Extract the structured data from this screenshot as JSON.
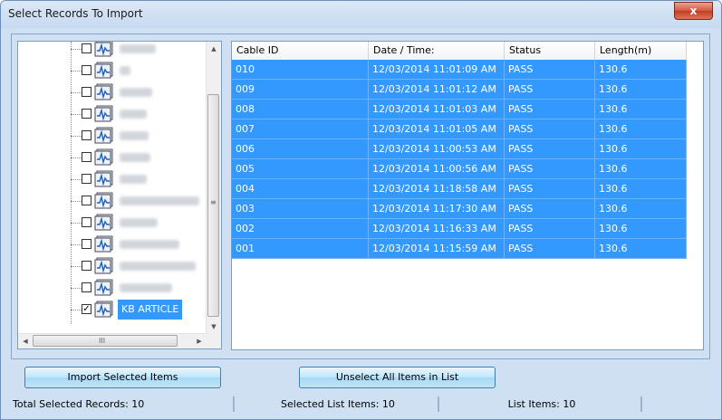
{
  "window": {
    "title": "Select Records To Import",
    "close_glyph": "x",
    "accent": "#3399ff"
  },
  "tree": {
    "nodes": [
      {
        "checked": false,
        "label_redacted": true,
        "icon": "cable-test-icon"
      },
      {
        "checked": false,
        "label_redacted": true,
        "icon": "cable-test-icon"
      },
      {
        "checked": false,
        "label_redacted": true,
        "icon": "cable-test-icon"
      },
      {
        "checked": false,
        "label_redacted": true,
        "icon": "cable-test-icon"
      },
      {
        "checked": false,
        "label_redacted": true,
        "icon": "cable-test-icon"
      },
      {
        "checked": false,
        "label_redacted": true,
        "icon": "cable-test-icon"
      },
      {
        "checked": false,
        "label_redacted": true,
        "icon": "cable-test-icon"
      },
      {
        "checked": false,
        "label_redacted": true,
        "icon": "cable-test-icon"
      },
      {
        "checked": false,
        "label_redacted": true,
        "icon": "cable-test-icon"
      },
      {
        "checked": false,
        "label_redacted": true,
        "icon": "cable-test-icon"
      },
      {
        "checked": false,
        "label_redacted": true,
        "icon": "cable-test-icon"
      },
      {
        "checked": false,
        "label_redacted": true,
        "icon": "cable-test-icon"
      },
      {
        "checked": true,
        "label": "KB ARTICLE",
        "selected": true,
        "icon": "cable-test-icon"
      }
    ],
    "hscroll_grip": "III"
  },
  "grid": {
    "columns": [
      "Cable ID",
      "Date / Time:",
      "Status",
      "Length(m)"
    ],
    "rows": [
      [
        "010",
        "12/03/2014  11:01:09 AM",
        "PASS",
        "130.6"
      ],
      [
        "009",
        "12/03/2014  11:01:12 AM",
        "PASS",
        "130.6"
      ],
      [
        "008",
        "12/03/2014  11:01:03 AM",
        "PASS",
        "130.6"
      ],
      [
        "007",
        "12/03/2014  11:01:05 AM",
        "PASS",
        "130.6"
      ],
      [
        "006",
        "12/03/2014  11:00:53 AM",
        "PASS",
        "130.6"
      ],
      [
        "005",
        "12/03/2014  11:00:56 AM",
        "PASS",
        "130.6"
      ],
      [
        "004",
        "12/03/2014  11:18:58 AM",
        "PASS",
        "130.6"
      ],
      [
        "003",
        "12/03/2014  11:17:30 AM",
        "PASS",
        "130.6"
      ],
      [
        "002",
        "12/03/2014  11:16:33 AM",
        "PASS",
        "130.6"
      ],
      [
        "001",
        "12/03/2014  11:15:59 AM",
        "PASS",
        "130.6"
      ]
    ]
  },
  "buttons": {
    "import_label": "Import Selected Items",
    "unselect_label": "Unselect All Items in List"
  },
  "status": {
    "total_selected": "Total Selected Records: 10",
    "selected_list": "Selected List Items: 10",
    "list_items": "List Items: 10"
  }
}
